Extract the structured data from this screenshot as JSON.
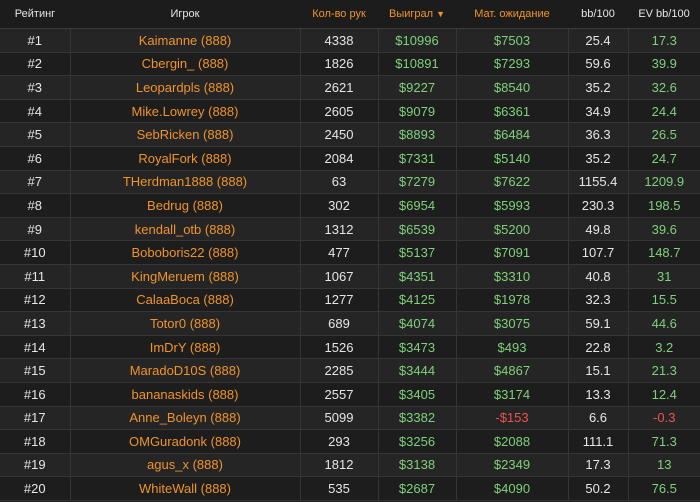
{
  "headers": {
    "rank": "Рейтинг",
    "player": "Игрок",
    "hands": "Кол-во рук",
    "won": "Выиграл",
    "expectation": "Мат. ожидание",
    "bb100": "bb/100",
    "ev_bb100": "EV bb/100"
  },
  "accent_color": "#f0932b",
  "positive_color": "#7fd17b",
  "negative_color": "#ef5350",
  "rows": [
    {
      "rank": "#1",
      "player": "Kaimanne (888)",
      "hands": "4338",
      "won": "$10996",
      "ev": "$7503",
      "bb": "25.4",
      "evbb": "17.3"
    },
    {
      "rank": "#2",
      "player": "Cbergin_ (888)",
      "hands": "1826",
      "won": "$10891",
      "ev": "$7293",
      "bb": "59.6",
      "evbb": "39.9"
    },
    {
      "rank": "#3",
      "player": "Leopardpls (888)",
      "hands": "2621",
      "won": "$9227",
      "ev": "$8540",
      "bb": "35.2",
      "evbb": "32.6"
    },
    {
      "rank": "#4",
      "player": "Mike.Lowrey (888)",
      "hands": "2605",
      "won": "$9079",
      "ev": "$6361",
      "bb": "34.9",
      "evbb": "24.4"
    },
    {
      "rank": "#5",
      "player": "SebRicken (888)",
      "hands": "2450",
      "won": "$8893",
      "ev": "$6484",
      "bb": "36.3",
      "evbb": "26.5"
    },
    {
      "rank": "#6",
      "player": "RoyalFork (888)",
      "hands": "2084",
      "won": "$7331",
      "ev": "$5140",
      "bb": "35.2",
      "evbb": "24.7"
    },
    {
      "rank": "#7",
      "player": "THerdman1888 (888)",
      "hands": "63",
      "won": "$7279",
      "ev": "$7622",
      "bb": "1155.4",
      "evbb": "1209.9"
    },
    {
      "rank": "#8",
      "player": "Bedrug (888)",
      "hands": "302",
      "won": "$6954",
      "ev": "$5993",
      "bb": "230.3",
      "evbb": "198.5"
    },
    {
      "rank": "#9",
      "player": "kendall_otb (888)",
      "hands": "1312",
      "won": "$6539",
      "ev": "$5200",
      "bb": "49.8",
      "evbb": "39.6"
    },
    {
      "rank": "#10",
      "player": "Boboboris22 (888)",
      "hands": "477",
      "won": "$5137",
      "ev": "$7091",
      "bb": "107.7",
      "evbb": "148.7"
    },
    {
      "rank": "#11",
      "player": "KingMeruem (888)",
      "hands": "1067",
      "won": "$4351",
      "ev": "$3310",
      "bb": "40.8",
      "evbb": "31"
    },
    {
      "rank": "#12",
      "player": "CalaaBoca (888)",
      "hands": "1277",
      "won": "$4125",
      "ev": "$1978",
      "bb": "32.3",
      "evbb": "15.5"
    },
    {
      "rank": "#13",
      "player": "Totor0 (888)",
      "hands": "689",
      "won": "$4074",
      "ev": "$3075",
      "bb": "59.1",
      "evbb": "44.6"
    },
    {
      "rank": "#14",
      "player": "ImDrY (888)",
      "hands": "1526",
      "won": "$3473",
      "ev": "$493",
      "bb": "22.8",
      "evbb": "3.2"
    },
    {
      "rank": "#15",
      "player": "MaradoD10S (888)",
      "hands": "2285",
      "won": "$3444",
      "ev": "$4867",
      "bb": "15.1",
      "evbb": "21.3"
    },
    {
      "rank": "#16",
      "player": "bananaskids (888)",
      "hands": "2557",
      "won": "$3405",
      "ev": "$3174",
      "bb": "13.3",
      "evbb": "12.4"
    },
    {
      "rank": "#17",
      "player": "Anne_Boleyn (888)",
      "hands": "5099",
      "won": "$3382",
      "ev": "-$153",
      "bb": "6.6",
      "evbb": "-0.3"
    },
    {
      "rank": "#18",
      "player": "OMGuradonk (888)",
      "hands": "293",
      "won": "$3256",
      "ev": "$2088",
      "bb": "111.1",
      "evbb": "71.3"
    },
    {
      "rank": "#19",
      "player": "agus_x (888)",
      "hands": "1812",
      "won": "$3138",
      "ev": "$2349",
      "bb": "17.3",
      "evbb": "13"
    },
    {
      "rank": "#20",
      "player": "WhiteWall (888)",
      "hands": "535",
      "won": "$2687",
      "ev": "$4090",
      "bb": "50.2",
      "evbb": "76.5"
    }
  ]
}
